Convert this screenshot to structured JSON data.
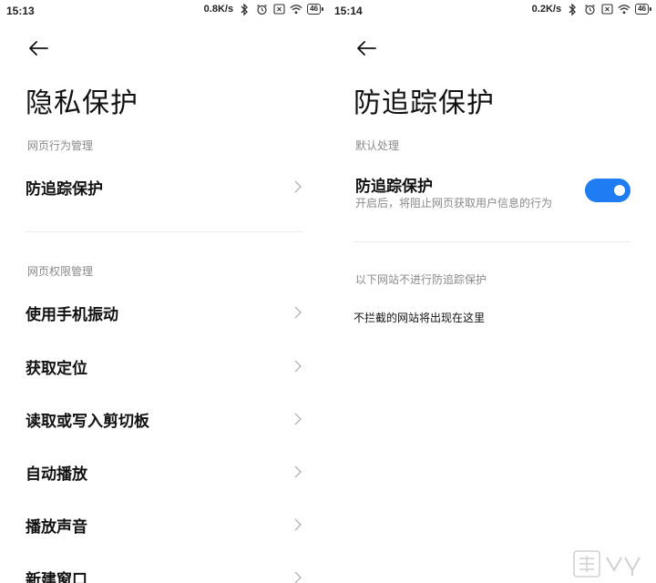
{
  "left": {
    "status": {
      "time": "15:13",
      "speed": "0.8K/s",
      "battery": "46"
    },
    "title": "隐私保护",
    "sections": [
      {
        "label": "网页行为管理",
        "items": [
          "防追踪保护"
        ]
      },
      {
        "label": "网页权限管理",
        "items": [
          "使用手机振动",
          "获取定位",
          "读取或写入剪切板",
          "自动播放",
          "播放声音",
          "新建窗口"
        ]
      }
    ]
  },
  "right": {
    "status": {
      "time": "15:14",
      "speed": "0.2K/s",
      "battery": "46"
    },
    "title": "防追踪保护",
    "section_default": "默认处理",
    "toggle": {
      "title": "防追踪保护",
      "subtitle": "开启后，将阻止网页获取用户信息的行为",
      "on": true
    },
    "section_exceptions": "以下网站不进行防追踪保护",
    "empty_note": "不拦截的网站将出现在这里"
  },
  "icons": {
    "back": "arrow-left-icon",
    "chevron": "chevron-right-icon",
    "bluetooth": "bluetooth-icon",
    "alarm": "alarm-clock-icon",
    "sim": "sim-off-icon",
    "wifi": "wifi-icon",
    "battery": "battery-icon"
  },
  "colors": {
    "accent": "#1f7cf2",
    "secondary_text": "#8a8a8a"
  }
}
